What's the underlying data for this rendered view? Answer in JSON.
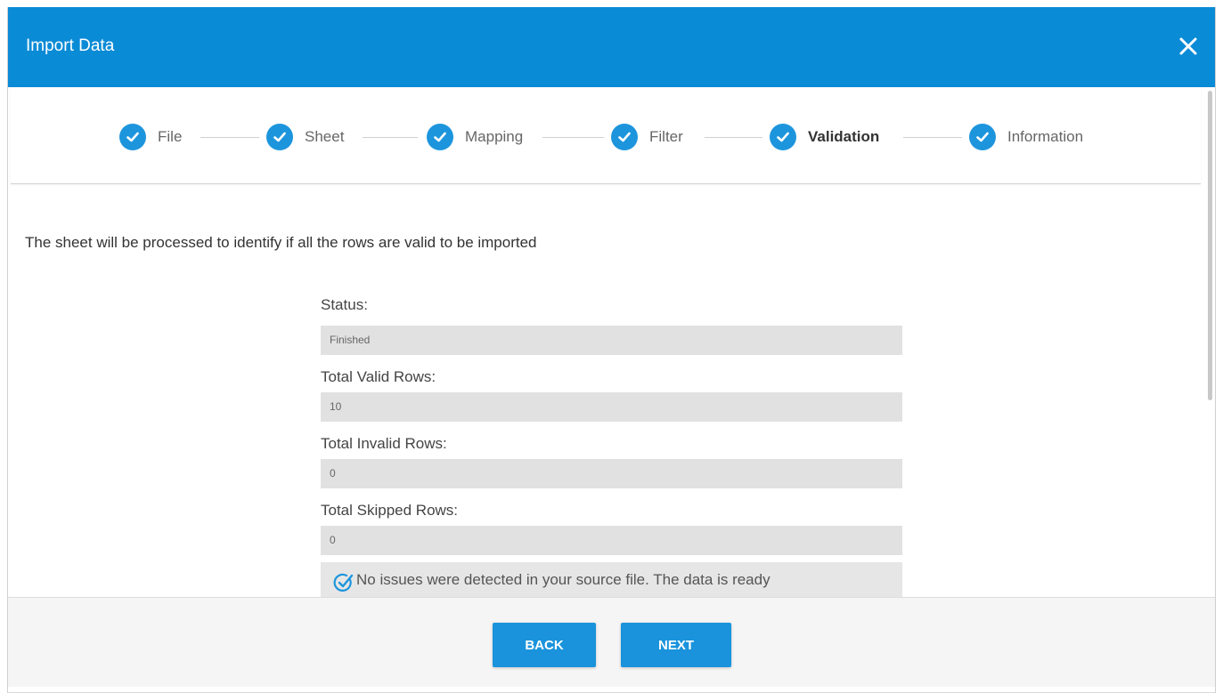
{
  "dialog": {
    "title": "Import Data",
    "close_icon": "close-icon"
  },
  "steps": [
    {
      "label": "File",
      "status": "completed",
      "icon": "check-icon"
    },
    {
      "label": "Sheet",
      "status": "completed",
      "icon": "check-icon"
    },
    {
      "label": "Mapping",
      "status": "completed",
      "icon": "check-icon"
    },
    {
      "label": "Filter",
      "status": "completed",
      "icon": "check-icon"
    },
    {
      "label": "Validation",
      "status": "active",
      "icon": "check-icon"
    },
    {
      "label": "Information",
      "status": "completed",
      "icon": "check-icon"
    }
  ],
  "description": "The sheet will be processed to identify if all the rows are valid to be imported",
  "fields": {
    "status": {
      "label": "Status:",
      "value": "Finished"
    },
    "valid": {
      "label": "Total Valid Rows:",
      "value": "10"
    },
    "invalid": {
      "label": "Total Invalid Rows:",
      "value": "0"
    },
    "skipped": {
      "label": "Total Skipped Rows:",
      "value": "0"
    }
  },
  "notice": {
    "icon": "check-circle-icon",
    "text": "No issues were detected in your source file. The data is ready"
  },
  "footer": {
    "back_label": "BACK",
    "next_label": "NEXT"
  },
  "colors": {
    "header": "#0a8bd6",
    "accent": "#1d95dd",
    "field_bg": "#e1e1e1"
  }
}
